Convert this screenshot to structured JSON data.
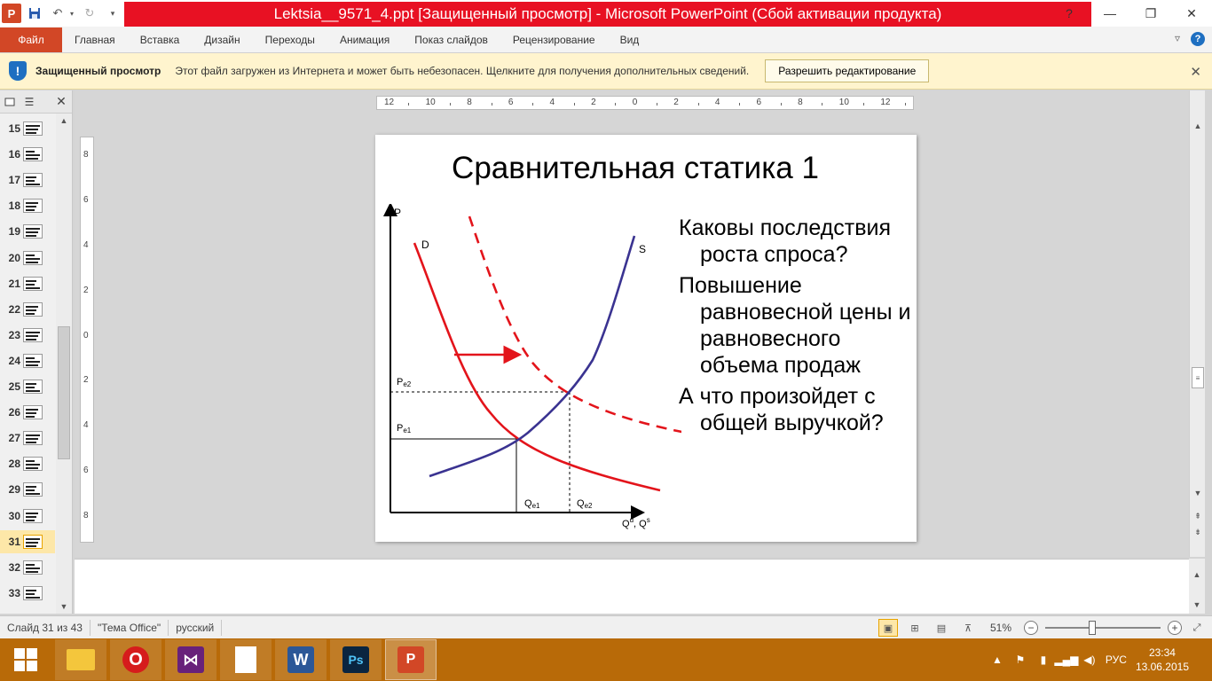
{
  "titlebar": {
    "title": "Lektsia__9571_4.ppt [Защищенный просмотр] - Microsoft PowerPoint (Сбой активации продукта)",
    "app_letter": "P"
  },
  "ribbon": {
    "file_label": "Файл",
    "tabs": [
      "Главная",
      "Вставка",
      "Дизайн",
      "Переходы",
      "Анимация",
      "Показ слайдов",
      "Рецензирование",
      "Вид"
    ]
  },
  "protected_view": {
    "title": "Защищенный просмотр",
    "message": "Этот файл загружен из Интернета и может быть небезопасен. Щелкните для получения дополнительных сведений.",
    "enable_button": "Разрешить редактирование"
  },
  "slides_pane": {
    "slides": [
      {
        "num": "15"
      },
      {
        "num": "16"
      },
      {
        "num": "17"
      },
      {
        "num": "18"
      },
      {
        "num": "19"
      },
      {
        "num": "20"
      },
      {
        "num": "21"
      },
      {
        "num": "22"
      },
      {
        "num": "23"
      },
      {
        "num": "24"
      },
      {
        "num": "25"
      },
      {
        "num": "26"
      },
      {
        "num": "27"
      },
      {
        "num": "28"
      },
      {
        "num": "29"
      },
      {
        "num": "30"
      },
      {
        "num": "31"
      },
      {
        "num": "32"
      },
      {
        "num": "33"
      }
    ],
    "selected": "31"
  },
  "rulers": {
    "horizontal": [
      "12",
      "10",
      "8",
      "6",
      "4",
      "2",
      "0",
      "2",
      "4",
      "6",
      "8",
      "10",
      "12"
    ],
    "vertical": [
      "8",
      "6",
      "4",
      "2",
      "0",
      "2",
      "4",
      "6",
      "8"
    ]
  },
  "slide": {
    "title": "Сравнительная статика 1",
    "bullets": [
      "Каковы последствия роста спроса?",
      "Повышение равновесной цены и равновесного объема продаж",
      "А что произойдет с общей выручкой?"
    ]
  },
  "chart_data": {
    "type": "line",
    "axis_labels": {
      "y": "P",
      "x_base": "Q",
      "x_sup1": "d",
      "x_sep": ", Q",
      "x_sup2": "s"
    },
    "curve_labels": {
      "demand": "D",
      "supply": "S"
    },
    "price_labels": [
      {
        "base": "P",
        "sub": "e2"
      },
      {
        "base": "P",
        "sub": "e1"
      }
    ],
    "quantity_labels": [
      {
        "base": "Q",
        "sub": "e1"
      },
      {
        "base": "Q",
        "sub": "e2"
      }
    ],
    "series": [
      {
        "name": "D",
        "style": "solid",
        "color": "#e3141b"
      },
      {
        "name": "S",
        "style": "solid",
        "color": "#3a3391"
      },
      {
        "name": "",
        "style": "dashed",
        "color": "#e3141b"
      }
    ],
    "annotation": "arrow-right"
  },
  "statusbar": {
    "slide_counter": "Слайд 31 из 43",
    "theme": "\"Тема Office\"",
    "language": "русский",
    "zoom": "51%",
    "zoom_level": 0.51
  },
  "taskbar": {
    "apps": [
      "explorer",
      "opera",
      "visual-studio",
      "document",
      "word",
      "photoshop",
      "powerpoint"
    ],
    "active_app": "powerpoint",
    "lang": "РУС",
    "time": "23:34",
    "date": "13.06.2015"
  },
  "colors": {
    "accent": "#d24726",
    "title_strip": "#e81123",
    "taskbar": "#b86a08",
    "demand": "#e3141b",
    "supply": "#3a3391"
  }
}
